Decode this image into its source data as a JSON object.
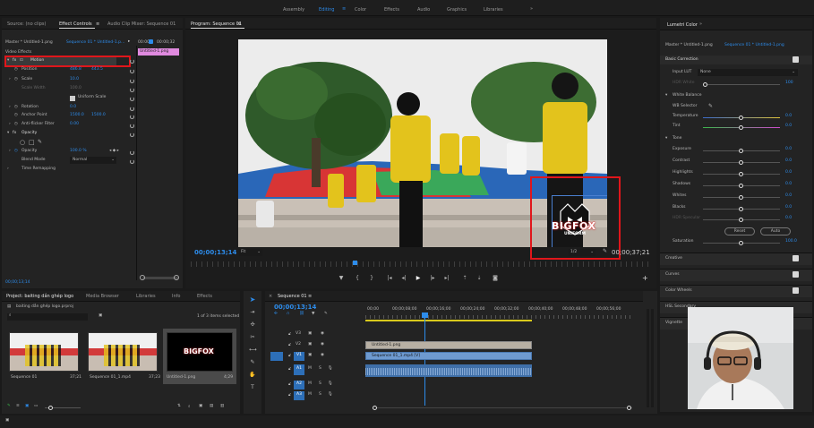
{
  "workspaces": [
    "Assembly",
    "Editing",
    "Color",
    "Effects",
    "Audio",
    "Graphics",
    "Libraries"
  ],
  "workspace_more": "»",
  "source_panel": {
    "tabs": [
      "Source: (no clips)",
      "Effect Controls",
      "Audio Clip Mixer: Sequence 01"
    ],
    "menu_glyph": "≡",
    "master_label": "Master * Untitled-1.png",
    "sequence_label": "Sequence 01 * Untitled-1.p...",
    "time_start": "00:00",
    "time_end": "00:00;32",
    "clip_chip": "Untitled-1.png",
    "video_effects": "Video Effects",
    "motion": "Motion",
    "position": {
      "label": "Position",
      "v1": "486.8",
      "v2": "443.5"
    },
    "scale": {
      "label": "Scale",
      "value": "10.0"
    },
    "scale_width": {
      "label": "Scale Width",
      "value": "100.0"
    },
    "uniform_scale": "Uniform Scale",
    "rotation": {
      "label": "Rotation",
      "value": "0.0"
    },
    "anchor_point": {
      "label": "Anchor Point",
      "v1": "1500.0",
      "v2": "1500.0"
    },
    "anti_flicker": {
      "label": "Anti-flicker Filter",
      "value": "0.00"
    },
    "opacity_group": "Opacity",
    "opacity": {
      "label": "Opacity",
      "value": "100.0 %"
    },
    "blend_mode": {
      "label": "Blend Mode",
      "value": "Normal"
    },
    "time_remapping": "Time Remapping",
    "timecode": "00;00;13;14"
  },
  "program_monitor": {
    "title": "Program: Sequence 01",
    "menu_glyph": "≡",
    "timecode_current": "00;00;13;14",
    "timecode_total": "00;00;37;21",
    "fit": "Fit",
    "quality": "1/2",
    "logo_text": "BIGFOX",
    "logo_sub": "UNIFORM"
  },
  "project_panel": {
    "tabs": [
      "Project: baiting dắn ghép logo",
      "Media Browser",
      "Libraries",
      "Info",
      "Effects"
    ],
    "file_name": "baiting dắn ghép logo.prproj",
    "selection_info": "1 of 3 items selected",
    "items": [
      {
        "name": "Sequence 01",
        "duration": "37;21"
      },
      {
        "name": "Sequence 01_1.mp4",
        "duration": "37;23"
      },
      {
        "name": "Untitled-1.png",
        "duration": "4;29"
      }
    ]
  },
  "timeline": {
    "tab": "Sequence 01",
    "menu_glyph": "≡",
    "timecode": "00;00;13;14",
    "ruler": [
      "00;00",
      "00;00;08;00",
      "00;00;16;00",
      "00;00;24;00",
      "00;00;32;00",
      "00;00;40;00",
      "00;00;48;00",
      "00;00;56;00"
    ],
    "tracks": [
      "V3",
      "V2",
      "V1",
      "A1",
      "A2",
      "A3"
    ],
    "clips": [
      {
        "name": "Untitled-1.png",
        "track": "V2"
      },
      {
        "name": "Sequence 01_1.mp4 [V]",
        "track": "V1"
      }
    ]
  },
  "lumetri": {
    "title": "Lumetri Color",
    "more": "»",
    "master_label": "Master * Untitled-1.png",
    "sequence_label": "Sequence 01 * Untitled-1.png",
    "basic_correction": "Basic Correction",
    "input_lut_label": "Input LUT",
    "input_lut_value": "None",
    "hdr_white": {
      "label": "HDR White",
      "value": "100"
    },
    "white_balance": "White Balance",
    "wb_selector": "WB Selector",
    "temperature": {
      "label": "Temperature",
      "value": "0.0"
    },
    "tint": {
      "label": "Tint",
      "value": "0.0"
    },
    "tone": "Tone",
    "exposure": {
      "label": "Exposure",
      "value": "0.0"
    },
    "contrast": {
      "label": "Contrast",
      "value": "0.0"
    },
    "highlights": {
      "label": "Highlights",
      "value": "0.0"
    },
    "shadows": {
      "label": "Shadows",
      "value": "0.0"
    },
    "whites": {
      "label": "Whites",
      "value": "0.0"
    },
    "blacks": {
      "label": "Blacks",
      "value": "0.0"
    },
    "hdr_specular": {
      "label": "HDR Specular",
      "value": "0.0"
    },
    "reset": "Reset",
    "auto": "Auto",
    "saturation": {
      "label": "Saturation",
      "value": "100.0"
    },
    "sections": [
      "Creative",
      "Curves",
      "Color Wheels",
      "HSL Secondary",
      "Vignette"
    ]
  },
  "colors": {
    "accent_blue": "#2d8ceb",
    "highlight_red": "#e0161b",
    "clip_pink": "#e08adf",
    "video_clip": "#6e9ad0",
    "audio_clip": "#3f6fa8"
  }
}
